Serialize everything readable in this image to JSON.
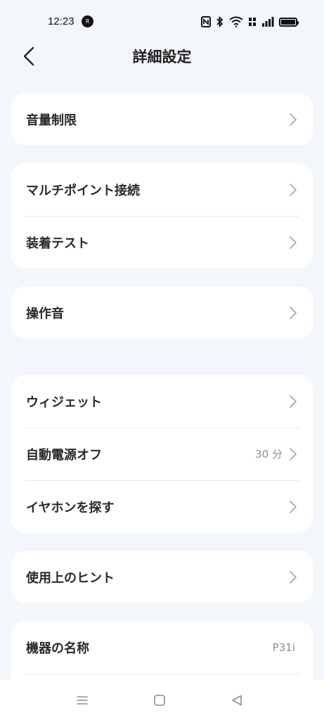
{
  "status_bar": {
    "time": "12:23",
    "notification_badge": "R"
  },
  "header": {
    "title": "詳細設定"
  },
  "groups": [
    {
      "items": [
        {
          "label": "音量制限",
          "value": ""
        }
      ]
    },
    {
      "items": [
        {
          "label": "マルチポイント接続",
          "value": ""
        },
        {
          "label": "装着テスト",
          "value": ""
        }
      ]
    },
    {
      "items": [
        {
          "label": "操作音",
          "value": ""
        }
      ]
    },
    {
      "items": [
        {
          "label": "ウィジェット",
          "value": ""
        },
        {
          "label": "自動電源オフ",
          "value": "30 分"
        },
        {
          "label": "イヤホンを探す",
          "value": ""
        }
      ]
    },
    {
      "items": [
        {
          "label": "使用上のヒント",
          "value": ""
        }
      ]
    },
    {
      "items": [
        {
          "label": "機器の名称",
          "value": "P31i"
        }
      ]
    }
  ],
  "icons": {
    "back": "back-arrow-icon",
    "chevron": "chevron-right-icon",
    "nav_menu": "menu-icon",
    "nav_home": "home-icon",
    "nav_back": "back-triangle-icon"
  },
  "colors": {
    "background": "#f3f6fa",
    "card": "#ffffff",
    "text": "#2a2a2a",
    "secondary_text": "#8a8f96"
  }
}
